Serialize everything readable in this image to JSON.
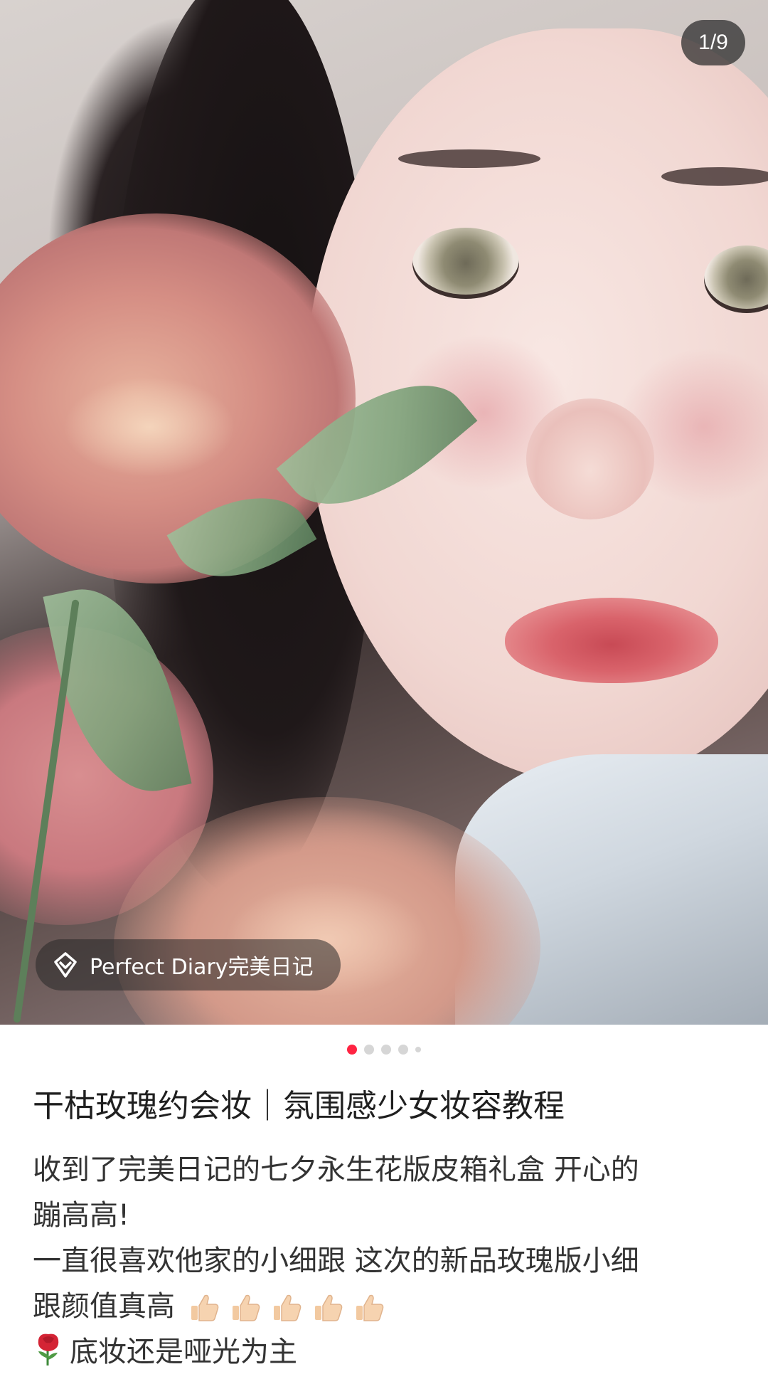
{
  "image_viewer": {
    "counter": "1/9",
    "total_dots": 5,
    "active_dot": 0,
    "brand_tag": "Perfect Diary完美日记"
  },
  "post": {
    "title": "干枯玫瑰约会妆｜氛围感少女妆容教程",
    "lines": [
      "收到了完美日记的七夕永生花版皮箱礼盒 开心的",
      "蹦高高!",
      "一直很喜欢他家的小细跟 这次的新品玫瑰版小细",
      "跟颜值真高",
      "底妆还是哑光为主"
    ],
    "thumbs_count": 5
  },
  "colors": {
    "accent": "#ff2442",
    "text": "#333333",
    "title": "#1f1f1f"
  },
  "icons": {
    "brand_tag": "brand-tag-icon",
    "thumbs": "thumbs-up-icon",
    "rose": "rose-icon"
  }
}
